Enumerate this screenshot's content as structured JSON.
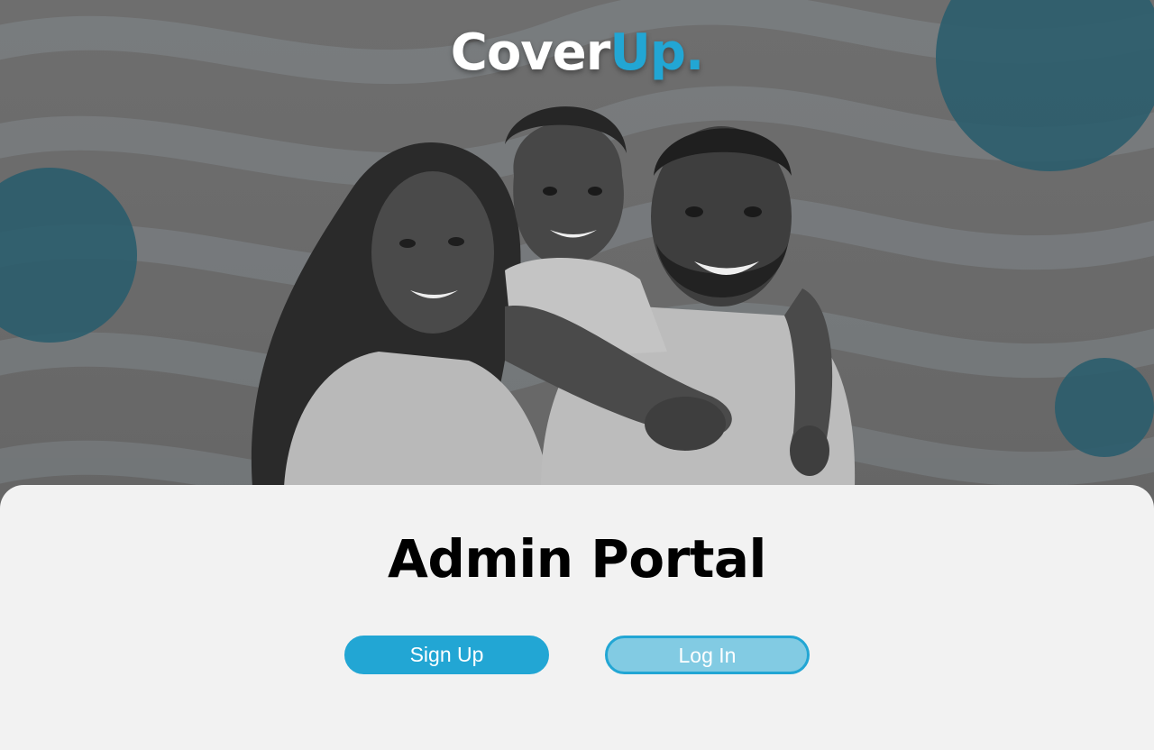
{
  "logo": {
    "part1": "Cover",
    "part2": "Up."
  },
  "hero": {
    "image": "family-photo"
  },
  "panel": {
    "title": "Admin Portal",
    "signup_label": "Sign Up",
    "login_label": "Log In"
  },
  "colors": {
    "accent": "#22a6d4",
    "accent_light": "#82cbe3",
    "panel_bg": "#f2f2f2",
    "hero_bg": "#6b6b6b",
    "circle": "#2b5d6d"
  }
}
